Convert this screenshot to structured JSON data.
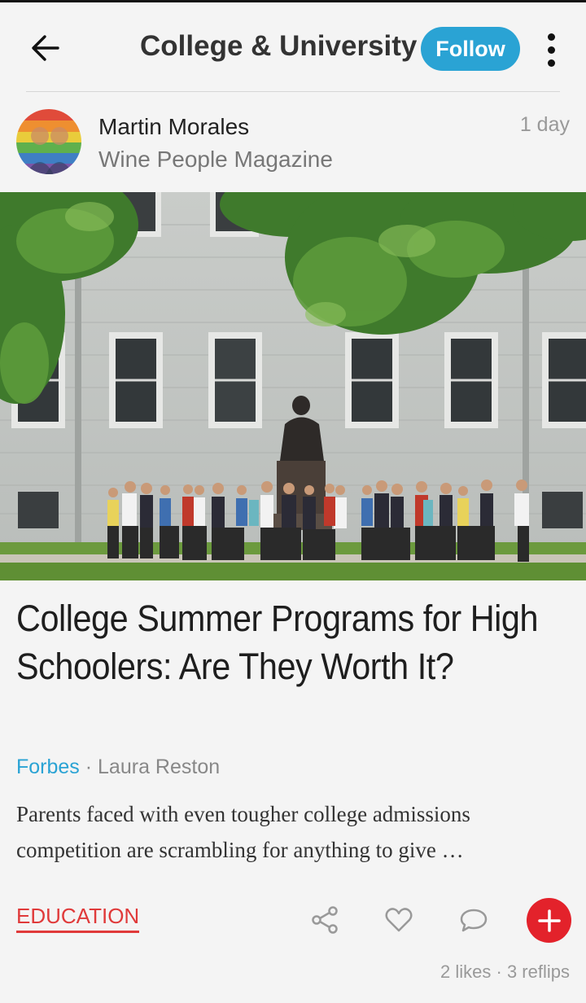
{
  "header": {
    "title": "College & University",
    "follow_label": "Follow"
  },
  "author": {
    "name": "Martin Morales",
    "subtitle": "Wine People Magazine",
    "time": "1 day"
  },
  "article": {
    "headline": "College Summer Programs for High Schoolers: Are They Worth It?",
    "source": "Forbes",
    "separator": " · ",
    "writer": "Laura Reston",
    "excerpt": "Parents faced with even tougher college admissions competition are scrambling for anything to give …"
  },
  "footer": {
    "tag": "EDUCATION",
    "stats": "2 likes · 3 reflips"
  },
  "icons": [
    "back-arrow-icon",
    "more-vertical-icon",
    "share-icon",
    "heart-icon",
    "comment-icon",
    "plus-icon"
  ],
  "colors": {
    "accent": "#2aa3d4",
    "tag": "#e03a3a",
    "add_button": "#e3222b",
    "background": "#f4f4f4"
  }
}
